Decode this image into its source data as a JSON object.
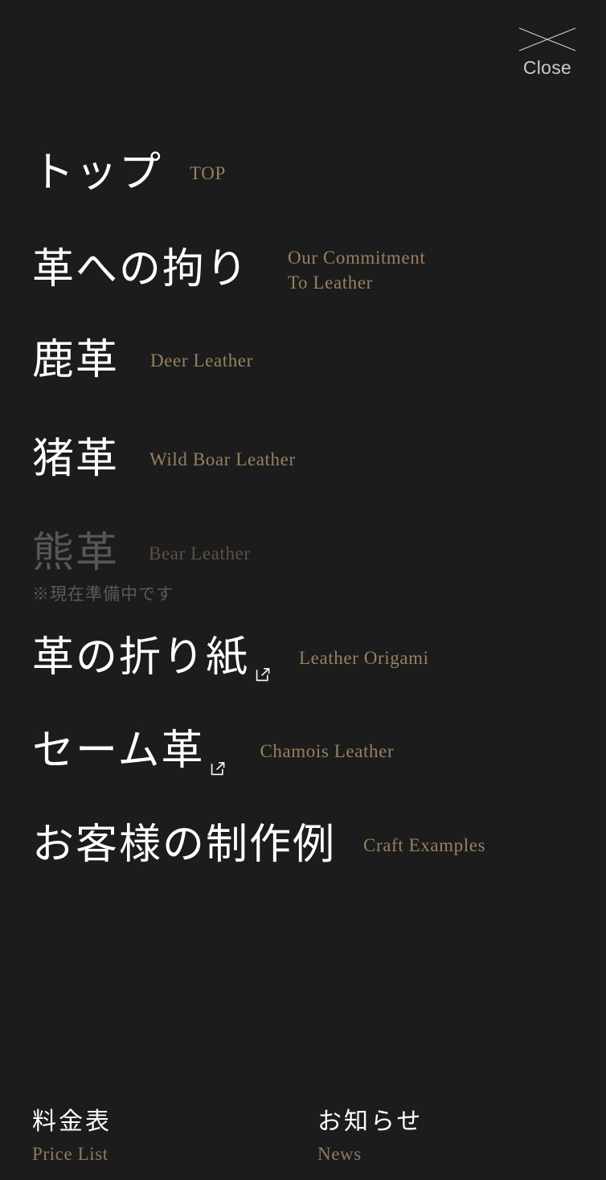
{
  "background_color": "#1c1c1c",
  "accent_color": "#97805f",
  "text_color": "#ffffff",
  "disabled_color": "#565656",
  "close": {
    "label": "Close",
    "icon": "close-x-icon"
  },
  "nav": {
    "items": [
      {
        "key": "top",
        "ja": "トップ",
        "en": "TOP",
        "disabled": false,
        "external": false
      },
      {
        "key": "commitment",
        "ja": "革への拘り",
        "en": "Our Commitment\nTo Leather",
        "disabled": false,
        "external": false
      },
      {
        "key": "deer",
        "ja": "鹿革",
        "en": "Deer Leather",
        "disabled": false,
        "external": false
      },
      {
        "key": "boar",
        "ja": "猪革",
        "en": "Wild Boar Leather",
        "disabled": false,
        "external": false
      },
      {
        "key": "bear",
        "ja": "熊革",
        "en": "Bear Leather",
        "note": "※現在準備中です",
        "disabled": true,
        "external": false
      },
      {
        "key": "origami",
        "ja": "革の折り紙",
        "en": "Leather Origami",
        "disabled": false,
        "external": true
      },
      {
        "key": "chamois",
        "ja": "セーム革",
        "en": "Chamois Leather",
        "disabled": false,
        "external": true
      },
      {
        "key": "craft",
        "ja": "お客様の制作例",
        "en": "Craft Examples",
        "disabled": false,
        "external": false
      }
    ]
  },
  "footer": {
    "links": [
      {
        "key": "price-list",
        "ja": "料金表",
        "en": "Price List"
      },
      {
        "key": "news",
        "ja": "お知らせ",
        "en": "News"
      }
    ]
  }
}
